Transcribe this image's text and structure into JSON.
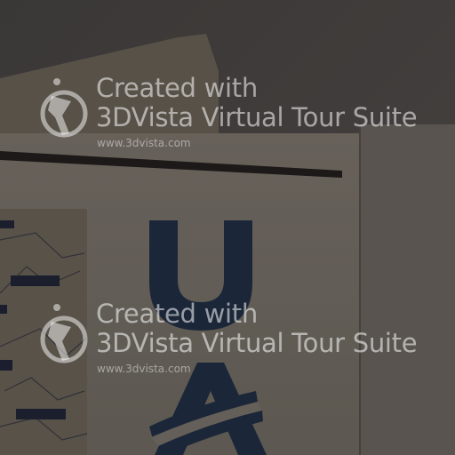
{
  "photo": {
    "subject": "wall sign with UA logo letters",
    "sign_letters": [
      "U",
      "A"
    ],
    "colors": {
      "wall": "#423f3d",
      "panel": "#5f594f",
      "sign_board": "#6a655e",
      "logo_navy": "#1d2a3c"
    }
  },
  "watermarks": [
    {
      "line1": "Created with",
      "line2": "3DVista Virtual Tour Suite",
      "url": "www.3dvista.com",
      "icon": "3dvista-logo-icon"
    },
    {
      "line1": "Created with",
      "line2": "3DVista Virtual Tour Suite",
      "url": "www.3dvista.com",
      "icon": "3dvista-logo-icon"
    }
  ]
}
